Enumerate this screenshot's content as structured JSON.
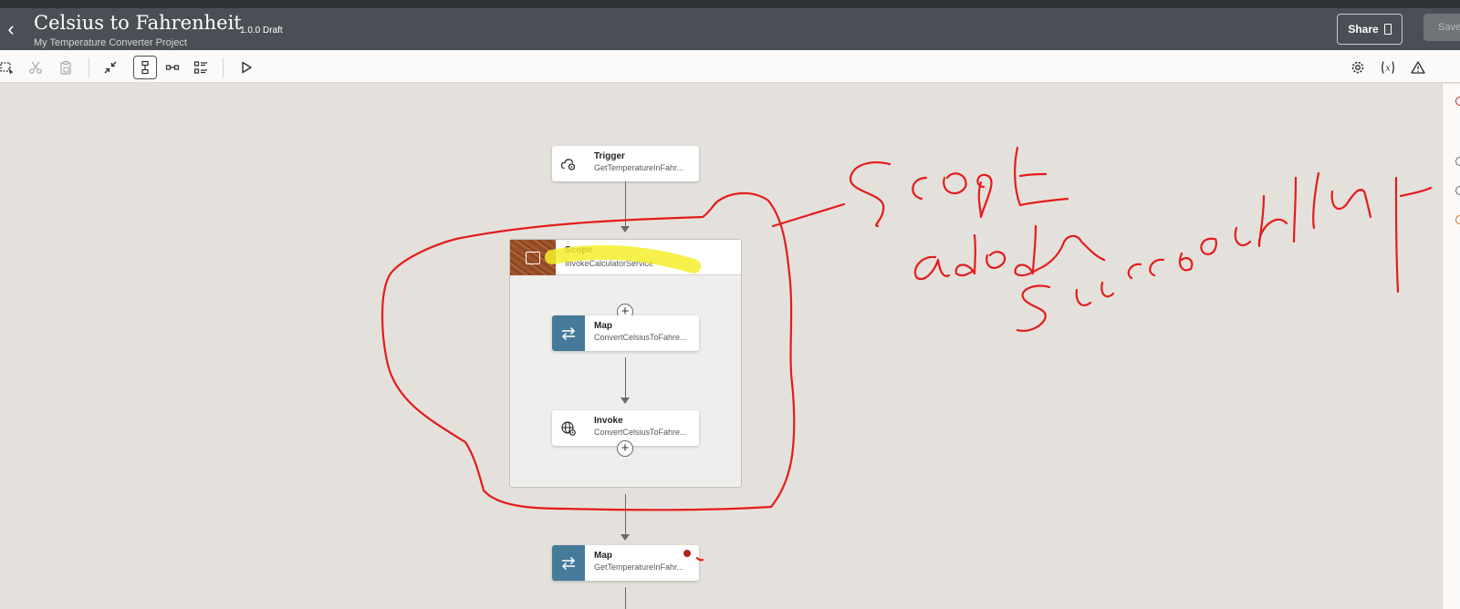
{
  "header": {
    "title": "Celsius to Fahrenheit",
    "version": "1.0.0 Draft",
    "subtitle": "My Temperature Converter Project",
    "share_label": "Share",
    "save_label": "Save"
  },
  "flow": {
    "trigger": {
      "title": "Trigger",
      "subtitle": "GetTemperatureInFahr..."
    },
    "scope": {
      "title": "Scope",
      "subtitle": "InvokeCalculatorService"
    },
    "map_inner": {
      "title": "Map",
      "subtitle": "ConvertCelsiusToFahre..."
    },
    "invoke": {
      "title": "Invoke",
      "subtitle": "ConvertCelsiusToFahre..."
    },
    "map_outer": {
      "title": "Map",
      "subtitle": "GetTemperatureInFahr..."
    }
  },
  "annotation": {
    "handwriting": "Scope added successfully",
    "color": "#e51b1b",
    "highlight_color": "#f4ee2a"
  },
  "colors": {
    "header_bg": "#4a4f55",
    "canvas_bg": "#e4e1dc",
    "node_accent": "#467a99",
    "error": "#b3261e"
  }
}
